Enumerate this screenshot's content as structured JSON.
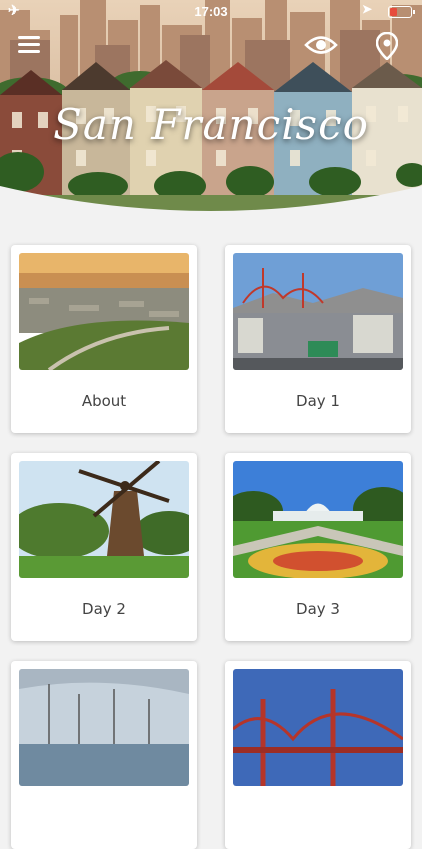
{
  "status_bar": {
    "time": "17:03"
  },
  "header": {
    "title": "San Francisco",
    "icons": [
      "menu-icon",
      "eye-icon",
      "location-pin-icon"
    ]
  },
  "cards": [
    {
      "label": "About"
    },
    {
      "label": "Day 1"
    },
    {
      "label": "Day 2"
    },
    {
      "label": "Day 3"
    },
    {
      "label": ""
    },
    {
      "label": ""
    }
  ],
  "colors": {
    "background": "#f2f2f2",
    "card": "#ffffff",
    "label": "#444444"
  }
}
